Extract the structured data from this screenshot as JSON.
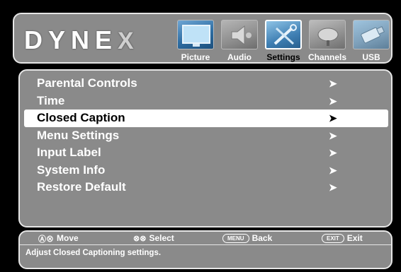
{
  "logo": {
    "text": "DYNE",
    "mark": "X"
  },
  "tabs": [
    {
      "label": "Picture",
      "icon": "tv-icon",
      "active": false
    },
    {
      "label": "Audio",
      "icon": "speaker-icon",
      "active": false
    },
    {
      "label": "Settings",
      "icon": "tools-icon",
      "active": true
    },
    {
      "label": "Channels",
      "icon": "satellite-dish-icon",
      "active": false
    },
    {
      "label": "USB",
      "icon": "usb-drive-icon",
      "active": false
    }
  ],
  "menu": {
    "items": [
      {
        "label": "Parental Controls",
        "arrow": "➤",
        "selected": false
      },
      {
        "label": "Time",
        "arrow": "➤",
        "selected": false
      },
      {
        "label": "Closed Caption",
        "arrow": "➤",
        "selected": true
      },
      {
        "label": "Menu Settings",
        "arrow": "➤",
        "selected": false
      },
      {
        "label": "Input Label",
        "arrow": "➤",
        "selected": false
      },
      {
        "label": "System Info",
        "arrow": "➤",
        "selected": false
      },
      {
        "label": "Restore Default",
        "arrow": "➤",
        "selected": false
      }
    ]
  },
  "footer": {
    "hints": {
      "move": {
        "icon": "Ⓐ⊗",
        "label": "Move"
      },
      "select": {
        "icon": "⊗⊗",
        "label": "Select"
      },
      "back": {
        "key": "MENU",
        "label": "Back"
      },
      "exit": {
        "key": "EXIT",
        "label": "Exit"
      }
    },
    "description": "Adjust Closed Captioning settings."
  },
  "colors": {
    "panel": "#8a8a8a",
    "border": "#e6e6e6",
    "highlight": "#ffffff",
    "tab_blue": "#3f7fb3"
  }
}
